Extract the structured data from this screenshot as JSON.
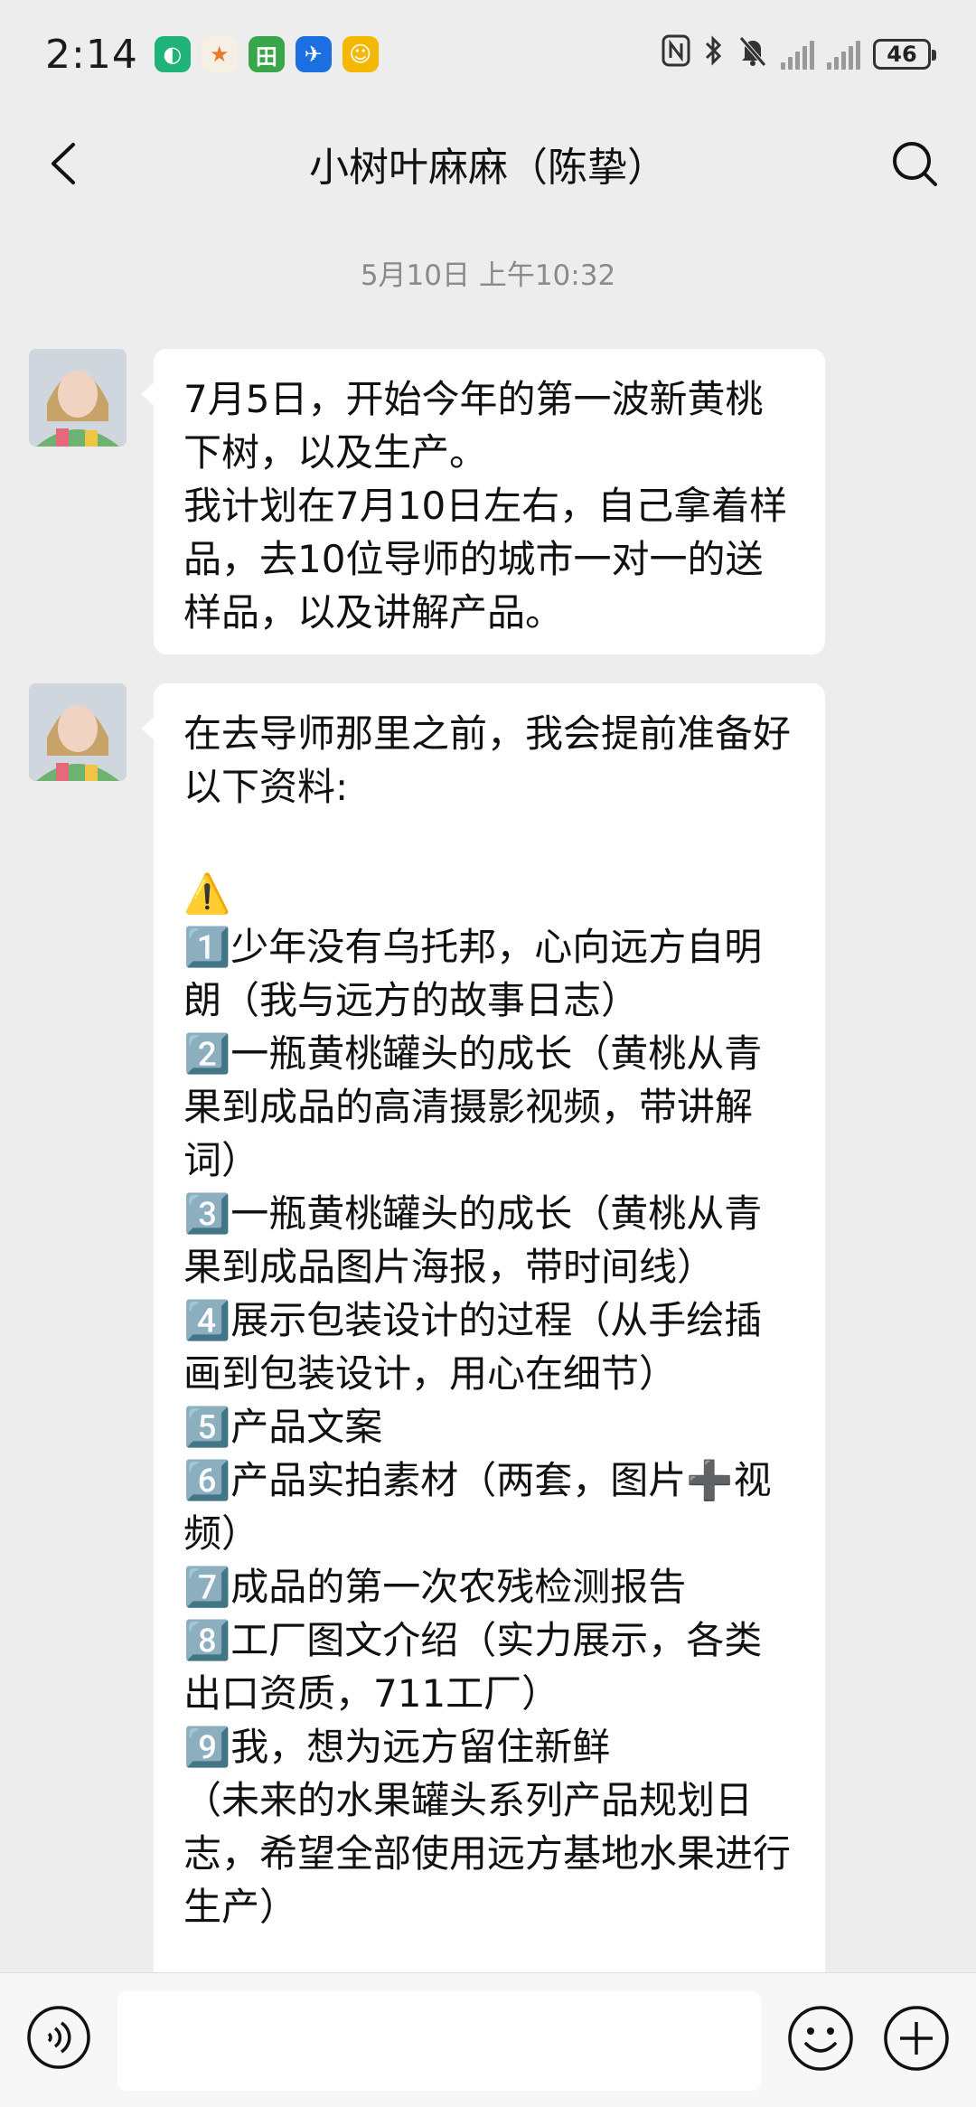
{
  "status": {
    "time": "2:14",
    "battery": "46",
    "app_icons": [
      {
        "name": "app-icon-green-circle",
        "color": "#1fb37a",
        "glyph": "◐"
      },
      {
        "name": "app-icon-orange",
        "color": "#f6f0e4",
        "glyph": "★"
      },
      {
        "name": "app-icon-green-square",
        "color": "#3aa64a",
        "glyph": "田"
      },
      {
        "name": "app-icon-blue-plane",
        "color": "#1c6fe0",
        "glyph": "✈"
      },
      {
        "name": "app-icon-yellow",
        "color": "#f5b800",
        "glyph": "☺"
      }
    ]
  },
  "nav": {
    "title": "小树叶麻麻（陈挚）"
  },
  "chat": {
    "timestamp": "5月10日 上午10:32",
    "messages": [
      {
        "text": "7月5日，开始今年的第一波新黄桃下树，以及生产。\n我计划在7月10日左右，自己拿着样品，去10位导师的城市一对一的送样品，以及讲解产品。"
      },
      {
        "text": "在去导师那里之前，我会提前准备好以下资料:\n\n⚠️\n1️⃣少年没有乌托邦，心向远方自明朗（我与远方的故事日志）\n2️⃣一瓶黄桃罐头的成长（黄桃从青果到成品的高清摄影视频，带讲解词）\n3️⃣一瓶黄桃罐头的成长（黄桃从青果到成品图片海报，带时间线）\n4️⃣展示包装设计的过程（从手绘插画到包装设计，用心在细节）\n5️⃣产品文案\n6️⃣产品实拍素材（两套，图片➕视频）\n7️⃣成品的第一次农残检测报告\n8️⃣工厂图文介绍（实力展示，各类出口资质，711工厂）\n9️⃣我，想为远方留住新鲜\n（未来的水果罐头系列产品规划日志，希望全部使用远方基地水果进行生产）"
      }
    ]
  },
  "input": {
    "placeholder": ""
  },
  "colors": {
    "background": "#ededed",
    "bubble": "#ffffff",
    "timestamp": "#8a8a8a"
  }
}
